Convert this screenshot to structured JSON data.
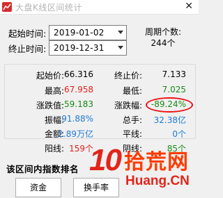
{
  "window": {
    "title": "大盘K线区间统计"
  },
  "dates": {
    "start_label": "起始时间:",
    "start_value": "2019-01-02",
    "end_label": "终止时间:",
    "end_value": "2019-12-31"
  },
  "period": {
    "label": "周期个数:",
    "value": "244个"
  },
  "stats": {
    "start_price_label": "起始价:",
    "start_price": "66.316",
    "end_price_label": "终止价:",
    "end_price": "7.133",
    "high_label": "最高:",
    "high": "67.958",
    "low_label": "最低:",
    "low": "7.025",
    "change_label": "涨跌值:",
    "change": "-59.183",
    "change_pct_label": "涨跌幅:",
    "change_pct": "-89.24%",
    "amplitude_label": "振幅:",
    "amplitude": "91.88%",
    "volume_label": "总手:",
    "volume": "32.38亿",
    "amount_label": "金额:",
    "amount": "2.89万亿",
    "flat_label": "平线:",
    "flat": "0个",
    "up_label": "阳线:",
    "up": "159个",
    "down_label": "阴线:",
    "down": "85个"
  },
  "ranking": {
    "title": "该区间内指数排名",
    "buttons": [
      "资金",
      "换手率"
    ]
  },
  "watermark": {
    "number": "10",
    "cn": "拾荒网",
    "url": "Huang.CN"
  },
  "colors": {
    "red": "#e02020",
    "green": "#1a8a1a",
    "blue": "#1f7ad8",
    "annotation": "#ee1111"
  }
}
